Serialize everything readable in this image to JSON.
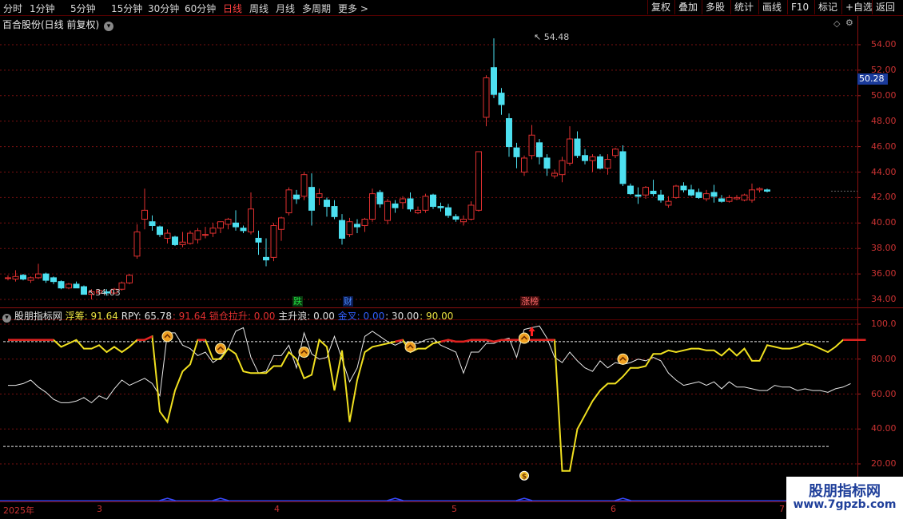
{
  "toolbar": {
    "timeframes": [
      "分时",
      "1分钟",
      "5分钟",
      "15分钟",
      "30分钟",
      "60分钟",
      "日线",
      "周线",
      "月线",
      "多周期",
      "更多 >"
    ],
    "active_timeframe": "日线",
    "buttons": [
      "复权",
      "叠加",
      "多股",
      "统计",
      "画线",
      "F10",
      "标记",
      "+自选",
      "返回"
    ]
  },
  "main": {
    "title": "百合股份(日线 前复权)",
    "price_axis": [
      "54.00",
      "52.00",
      "50.00",
      "48.00",
      "46.00",
      "44.00",
      "42.00",
      "40.00",
      "38.00",
      "36.00",
      "34.00"
    ],
    "current_price": "50.28",
    "high_label": "54.48",
    "low_label": "34.03",
    "events": [
      {
        "text": "跌",
        "color": "#1fae3a"
      },
      {
        "text": "财",
        "color": "#2a62d8"
      },
      {
        "text": "涨榜",
        "color": "#d43a3a"
      }
    ]
  },
  "indicator": {
    "name": "股朋指标网",
    "fields": [
      {
        "label": "浮筹: 91.64",
        "color": "#e8e040"
      },
      {
        "label": "RPY: 65.78",
        "color": "#e0e0e0"
      },
      {
        "label": ": 91.64",
        "color": "#e03030"
      },
      {
        "label": "锁仓拉升: 0.00",
        "color": "#e03030"
      },
      {
        "label": "主升浪: 0.00",
        "color": "#e0e0e0"
      },
      {
        "label": "金叉: 0.00",
        "color": "#3060ff"
      },
      {
        "label": ": 30.00",
        "color": "#e0e0e0"
      },
      {
        "label": ": 90.00",
        "color": "#e8e040"
      }
    ],
    "axis": [
      "100.0",
      "80.00",
      "60.00",
      "40.00",
      "20.00"
    ]
  },
  "date_axis": [
    "2025年",
    "3",
    "4",
    "5",
    "6",
    "7"
  ],
  "watermark": {
    "line1": "股朋指标网",
    "line2": "www.7gpzb.com"
  },
  "colors": {
    "up": "#e03030",
    "down": "#4de0f0",
    "yellow": "#f0e020",
    "white": "#e8e8e8",
    "grid": "#7a1010"
  },
  "chart_data": {
    "type": "candlestick",
    "series": [
      {
        "name": "K线",
        "ohlc": [
          [
            35.7,
            35.9,
            35.5,
            35.7
          ],
          [
            35.6,
            36.3,
            35.4,
            35.8
          ],
          [
            35.9,
            36.0,
            35.5,
            35.6
          ],
          [
            35.5,
            35.8,
            35.3,
            35.7
          ],
          [
            35.7,
            36.8,
            35.6,
            36.0
          ],
          [
            36.0,
            36.1,
            35.3,
            35.5
          ],
          [
            35.7,
            35.8,
            35.2,
            35.4
          ],
          [
            35.4,
            35.5,
            34.8,
            34.9
          ],
          [
            34.9,
            35.3,
            34.8,
            35.2
          ],
          [
            35.2,
            35.4,
            34.9,
            34.9
          ],
          [
            35.0,
            35.1,
            34.4,
            34.4
          ],
          [
            34.4,
            34.8,
            34.0,
            34.6
          ],
          [
            34.5,
            34.8,
            34.4,
            34.7
          ],
          [
            34.6,
            34.8,
            34.3,
            34.5
          ],
          [
            34.5,
            34.9,
            34.4,
            34.8
          ],
          [
            34.8,
            35.4,
            34.7,
            35.3
          ],
          [
            35.3,
            36.0,
            35.2,
            35.9
          ],
          [
            37.4,
            39.9,
            37.2,
            39.3
          ],
          [
            40.3,
            42.7,
            39.5,
            41.0
          ],
          [
            40.1,
            40.6,
            39.4,
            39.8
          ],
          [
            39.7,
            39.8,
            38.9,
            39.1
          ],
          [
            38.8,
            39.5,
            38.4,
            39.2
          ],
          [
            38.9,
            39.0,
            38.2,
            38.3
          ],
          [
            38.3,
            39.3,
            38.1,
            38.5
          ],
          [
            38.4,
            39.4,
            38.3,
            39.2
          ],
          [
            38.7,
            39.6,
            38.4,
            39.4
          ],
          [
            39.1,
            39.7,
            38.8,
            39.1
          ],
          [
            39.2,
            40.0,
            38.9,
            39.6
          ],
          [
            39.6,
            40.1,
            39.2,
            40.1
          ],
          [
            39.9,
            40.4,
            39.5,
            40.3
          ],
          [
            40.0,
            41.0,
            39.4,
            39.7
          ],
          [
            39.6,
            39.8,
            39.2,
            39.4
          ],
          [
            39.3,
            42.4,
            39.1,
            41.1
          ],
          [
            38.8,
            39.4,
            37.5,
            38.5
          ],
          [
            37.3,
            38.8,
            36.6,
            37.1
          ],
          [
            37.3,
            40.0,
            37.0,
            39.8
          ],
          [
            39.5,
            40.5,
            38.6,
            40.4
          ],
          [
            40.8,
            42.8,
            40.6,
            42.6
          ],
          [
            42.2,
            42.6,
            41.5,
            41.9
          ],
          [
            42.1,
            44.0,
            41.8,
            43.8
          ],
          [
            42.8,
            43.9,
            39.8,
            41.0
          ],
          [
            42.0,
            42.7,
            41.4,
            42.3
          ],
          [
            41.8,
            42.0,
            40.5,
            41.3
          ],
          [
            41.3,
            41.8,
            40.3,
            40.5
          ],
          [
            40.2,
            40.7,
            38.3,
            38.8
          ],
          [
            39.1,
            40.4,
            38.9,
            40.1
          ],
          [
            39.9,
            40.3,
            39.2,
            39.7
          ],
          [
            39.8,
            40.4,
            39.3,
            40.3
          ],
          [
            40.3,
            42.7,
            40.1,
            42.3
          ],
          [
            42.4,
            42.6,
            41.2,
            41.5
          ],
          [
            40.2,
            41.9,
            39.9,
            41.7
          ],
          [
            41.5,
            41.8,
            40.8,
            41.2
          ],
          [
            41.6,
            42.1,
            41.1,
            41.9
          ],
          [
            41.9,
            42.4,
            40.9,
            41.1
          ],
          [
            40.8,
            41.3,
            40.7,
            41.0
          ],
          [
            41.0,
            42.3,
            40.8,
            42.1
          ],
          [
            42.2,
            42.3,
            41.1,
            41.3
          ],
          [
            41.3,
            41.6,
            40.9,
            41.2
          ],
          [
            41.2,
            41.5,
            40.4,
            40.6
          ],
          [
            40.5,
            40.7,
            40.1,
            40.3
          ],
          [
            40.1,
            40.6,
            39.8,
            40.3
          ],
          [
            40.3,
            41.7,
            40.2,
            41.4
          ],
          [
            41.0,
            45.6,
            40.9,
            45.6
          ],
          [
            48.3,
            51.6,
            47.6,
            51.4
          ],
          [
            52.2,
            54.5,
            49.8,
            50.1
          ],
          [
            50.2,
            50.6,
            48.5,
            49.3
          ],
          [
            48.2,
            48.6,
            45.2,
            46.0
          ],
          [
            45.9,
            46.3,
            44.3,
            45.2
          ],
          [
            44.0,
            45.3,
            43.7,
            45.1
          ],
          [
            45.3,
            47.7,
            45.0,
            46.9
          ],
          [
            46.3,
            46.6,
            44.6,
            45.2
          ],
          [
            45.1,
            45.4,
            43.7,
            44.3
          ],
          [
            43.7,
            44.2,
            43.5,
            43.9
          ],
          [
            43.8,
            45.2,
            43.2,
            44.9
          ],
          [
            44.7,
            47.6,
            44.5,
            46.6
          ],
          [
            46.6,
            47.2,
            45.1,
            45.3
          ],
          [
            45.3,
            45.8,
            44.6,
            44.9
          ],
          [
            44.9,
            45.4,
            44.0,
            45.2
          ],
          [
            45.2,
            45.4,
            44.2,
            44.3
          ],
          [
            44.3,
            45.4,
            43.8,
            45.0
          ],
          [
            45.3,
            45.9,
            45.1,
            45.8
          ],
          [
            45.6,
            46.1,
            42.9,
            43.1
          ],
          [
            42.9,
            43.1,
            42.2,
            42.3
          ],
          [
            42.2,
            42.8,
            41.5,
            42.1
          ],
          [
            42.2,
            42.9,
            41.9,
            42.8
          ],
          [
            42.5,
            43.4,
            42.1,
            42.3
          ],
          [
            42.2,
            42.6,
            41.6,
            41.8
          ],
          [
            41.4,
            42.1,
            41.2,
            41.7
          ],
          [
            42.0,
            43.0,
            41.9,
            42.9
          ],
          [
            42.9,
            43.2,
            42.4,
            42.6
          ],
          [
            42.6,
            43.0,
            42.1,
            42.2
          ],
          [
            42.4,
            42.7,
            41.9,
            42.0
          ],
          [
            41.9,
            42.6,
            41.7,
            42.3
          ],
          [
            42.4,
            43.0,
            41.6,
            42.1
          ],
          [
            41.9,
            42.2,
            41.6,
            41.7
          ],
          [
            41.7,
            42.2,
            41.6,
            42.0
          ],
          [
            41.9,
            42.2,
            41.8,
            42.0
          ],
          [
            41.8,
            42.3,
            41.7,
            42.2
          ],
          [
            41.8,
            43.1,
            41.6,
            42.6
          ],
          [
            42.6,
            42.8,
            42.4,
            42.7
          ],
          [
            42.6,
            42.7,
            42.4,
            42.5
          ]
        ]
      },
      {
        "name": "浮筹",
        "values": [
          91,
          91,
          91,
          91,
          91,
          91,
          91,
          87,
          89,
          91,
          86,
          86,
          88,
          84,
          87,
          84,
          87,
          91,
          91,
          93,
          50,
          44,
          62,
          73,
          77,
          91,
          91,
          80,
          80,
          86,
          83,
          73,
          72,
          72,
          72,
          76,
          76,
          84,
          80,
          69,
          71,
          91,
          87,
          62,
          85,
          44,
          68,
          84,
          87,
          88,
          89,
          90,
          91,
          84,
          86,
          86,
          89,
          90,
          91,
          90,
          90,
          91,
          91,
          91,
          90,
          91,
          91,
          91,
          91,
          91,
          91,
          91,
          91,
          16,
          16,
          40,
          48,
          56,
          62,
          66,
          66,
          70,
          75,
          75,
          76,
          83,
          83,
          85,
          84,
          85,
          86,
          86,
          85,
          85,
          82,
          86,
          82,
          86,
          79,
          79,
          88,
          87,
          86,
          86,
          87,
          89,
          88,
          86,
          84,
          87,
          91,
          91,
          91,
          91
        ]
      },
      {
        "name": "RPY",
        "values": [
          65,
          65,
          66,
          68,
          64,
          61,
          57,
          55,
          55,
          56,
          58,
          55,
          59,
          57,
          63,
          68,
          65,
          67,
          69,
          66,
          59,
          95,
          95,
          88,
          86,
          82,
          84,
          78,
          81,
          86,
          96,
          98,
          81,
          72,
          73,
          82,
          82,
          88,
          75,
          95,
          83,
          80,
          81,
          93,
          80,
          67,
          75,
          93,
          96,
          93,
          90,
          88,
          90,
          89,
          89,
          91,
          92,
          88,
          86,
          84,
          72,
          84,
          84,
          89,
          89,
          91,
          92,
          81,
          97,
          98,
          99,
          92,
          81,
          78,
          84,
          79,
          75,
          73,
          79,
          75,
          78,
          77,
          78,
          80,
          79,
          81,
          79,
          72,
          68,
          65,
          66,
          67,
          65,
          67,
          63,
          67,
          64,
          64,
          63,
          62,
          62,
          65,
          64,
          64,
          62,
          63,
          62,
          62,
          61,
          63,
          64,
          66
        ]
      }
    ],
    "x_axis_months": [
      "2025年",
      "3",
      "4",
      "5",
      "6",
      "7"
    ],
    "y_price_range": [
      33.5,
      55.5
    ],
    "y_indicator_range": [
      14,
      103
    ],
    "reference_lines": [
      90,
      30
    ],
    "annotations": [
      {
        "text": "54.48",
        "type": "high"
      },
      {
        "text": "34.03",
        "type": "low"
      }
    ]
  }
}
